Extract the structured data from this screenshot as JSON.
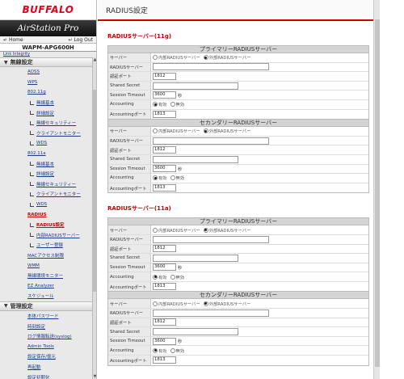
{
  "brand": {
    "logo_text": "BUFFALO",
    "product_line": "AirStation Pro"
  },
  "nav": {
    "home_label": "Home",
    "logout_label": "Log Out"
  },
  "model": "WAPM-APG600H",
  "link_integrity_label": "Link Integrity",
  "sidebar": {
    "wireless_section": "無線設定",
    "wireless_items": [
      {
        "label": "AOSS",
        "type": "item"
      },
      {
        "label": "WPS",
        "type": "item"
      },
      {
        "label": "802.11g",
        "type": "item"
      },
      {
        "label": "無線基本",
        "type": "sub"
      },
      {
        "label": "詳細設定",
        "type": "sub"
      },
      {
        "label": "無線セキュリティー",
        "type": "sub"
      },
      {
        "label": "クライアントモニター",
        "type": "sub"
      },
      {
        "label": "WDS",
        "type": "sub"
      },
      {
        "label": "802.11a",
        "type": "item"
      },
      {
        "label": "無線基本",
        "type": "sub"
      },
      {
        "label": "詳細設定",
        "type": "sub"
      },
      {
        "label": "無線セキュリティー",
        "type": "sub"
      },
      {
        "label": "クライアントモニター",
        "type": "sub"
      },
      {
        "label": "WDS",
        "type": "sub"
      },
      {
        "label": "RADIUS",
        "type": "item-active"
      },
      {
        "label": "RADIUS設定",
        "type": "sub-active"
      },
      {
        "label": "内部RADIUSサーバー",
        "type": "sub"
      },
      {
        "label": "ユーザー登録",
        "type": "sub"
      },
      {
        "label": "MACアクセス制限",
        "type": "item"
      },
      {
        "label": "WMM",
        "type": "item"
      },
      {
        "label": "無線環境モニター",
        "type": "item"
      },
      {
        "label": "EZ Analyzer",
        "type": "item"
      },
      {
        "label": "スケジュール",
        "type": "item"
      }
    ],
    "admin_section": "管理設定",
    "admin_items": [
      {
        "label": "本体パスワード",
        "type": "item"
      },
      {
        "label": "時刻設定",
        "type": "item"
      },
      {
        "label": "ログ情報転送(syslog)",
        "type": "item"
      },
      {
        "label": "Admin Tools",
        "type": "item"
      },
      {
        "label": "設定保存/復元",
        "type": "item"
      },
      {
        "label": "再起動",
        "type": "item"
      },
      {
        "label": "設定初期化",
        "type": "item"
      }
    ]
  },
  "page_title": "RADIUS設定",
  "labels": {
    "server": "サーバー",
    "radius_server": "RADIUSサーバー",
    "auth_port": "認証ポート",
    "shared_secret": "Shared Secret",
    "session_timeout": "Session Timeout",
    "accounting": "Accounting",
    "accounting_port": "Accountingポート",
    "internal_radius": "内部RADIUSサーバー",
    "external_radius": "外部RADIUSサーバー",
    "enable": "有効",
    "disable": "無効",
    "seconds_unit": "秒"
  },
  "sections": [
    {
      "title": "RADIUSサーバー(11g)",
      "panels": [
        {
          "heading": "プライマリーRADIUSサーバー",
          "server": "external",
          "radius_server": "",
          "auth_port": "1812",
          "shared_secret": "",
          "session_timeout": "3600",
          "accounting": "enable",
          "accounting_port": "1813"
        },
        {
          "heading": "セカンダリーRADIUSサーバー",
          "server": "external",
          "radius_server": "",
          "auth_port": "1812",
          "shared_secret": "",
          "session_timeout": "3600",
          "accounting": "enable",
          "accounting_port": "1813"
        }
      ]
    },
    {
      "title": "RADIUSサーバー(11a)",
      "panels": [
        {
          "heading": "プライマリーRADIUSサーバー",
          "server": "external",
          "radius_server": "",
          "auth_port": "1812",
          "shared_secret": "",
          "session_timeout": "3600",
          "accounting": "enable",
          "accounting_port": "1813"
        },
        {
          "heading": "セカンダリーRADIUSサーバー",
          "server": "external",
          "radius_server": "",
          "auth_port": "1812",
          "shared_secret": "",
          "session_timeout": "3600",
          "accounting": "enable",
          "accounting_port": "1813"
        }
      ]
    }
  ],
  "colors": {
    "brand_red": "#e3001b",
    "accent_red": "#cc0000",
    "link_blue": "#1a3a8a"
  }
}
